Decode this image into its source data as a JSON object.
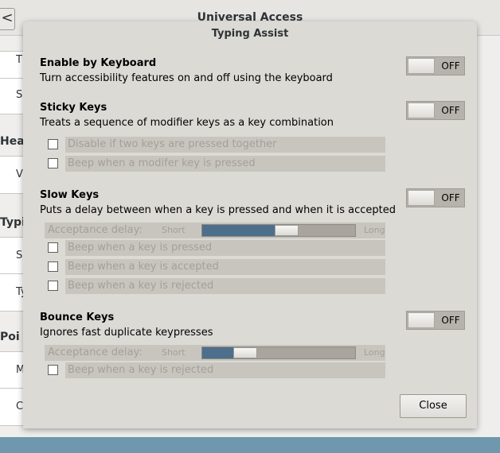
{
  "parent_window": {
    "title": "Universal Access",
    "back_label": "<",
    "sidebar_fragments": [
      "T",
      "S",
      "Hea",
      "V",
      "Typi",
      "S",
      "Ty",
      "Poi",
      "M",
      "C"
    ]
  },
  "dialog": {
    "title": "Typing Assist",
    "sections": [
      {
        "title": "Enable by Keyboard",
        "description": "Turn accessibility features on and off using the keyboard",
        "switch_label": "OFF"
      },
      {
        "title": "Sticky Keys",
        "description": "Treats a sequence of modifier keys as a key combination",
        "switch_label": "OFF",
        "options": [
          "Disable if two keys are pressed together",
          "Beep when a modifer key is pressed"
        ]
      },
      {
        "title": "Slow Keys",
        "description": "Puts a delay between when a key is pressed and when it is accepted",
        "switch_label": "OFF",
        "slider": {
          "label": "Acceptance delay:",
          "min_label": "Short",
          "max_label": "Long",
          "value": 0.55
        },
        "options": [
          "Beep when a key is pressed",
          "Beep when a key is accepted",
          "Beep when a key is rejected"
        ]
      },
      {
        "title": "Bounce Keys",
        "description": "Ignores fast duplicate keypresses",
        "switch_label": "OFF",
        "slider": {
          "label": "Acceptance delay:",
          "min_label": "Short",
          "max_label": "Long",
          "value": 0.28
        },
        "options": [
          "Beep when a key is rejected"
        ]
      }
    ],
    "close_label": "Close"
  },
  "colors": {
    "dialog_bg": "#dcdad5",
    "slider_fill": "#4d6f8c",
    "disabled_text": "#a3a09b",
    "desktop": "#6f97ad"
  }
}
